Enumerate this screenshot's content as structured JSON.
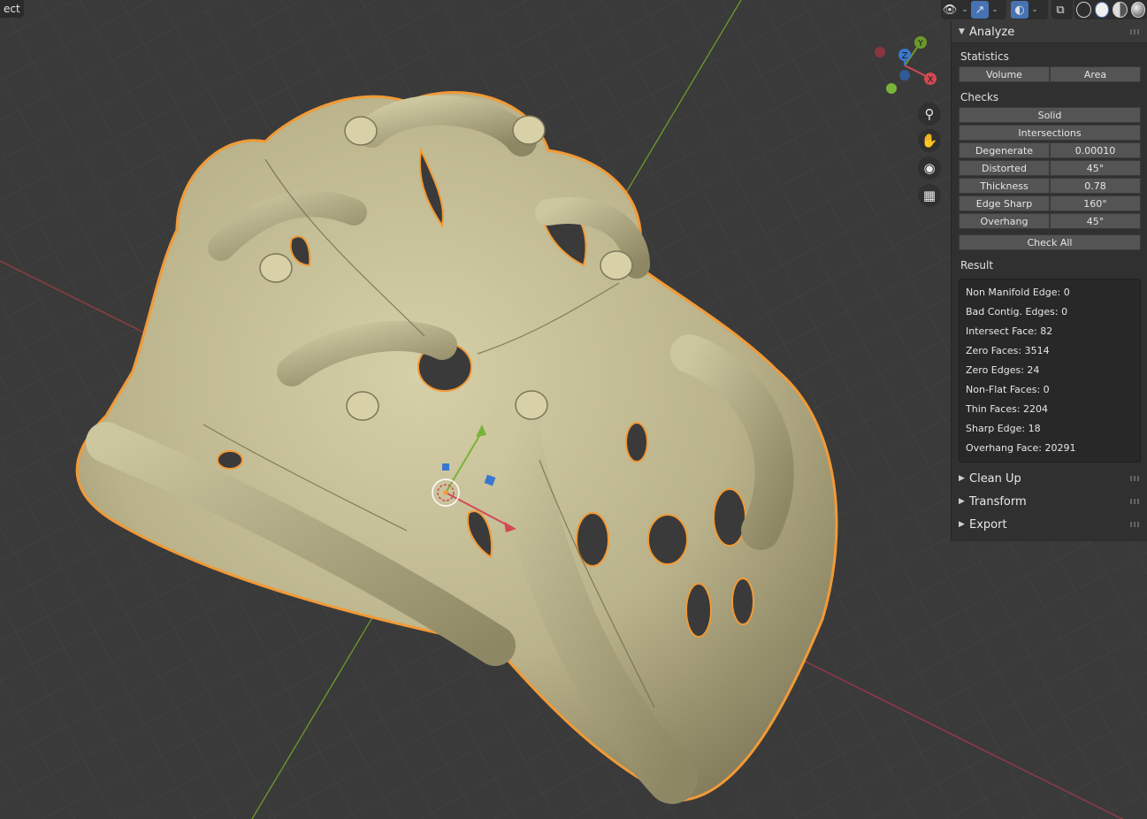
{
  "mode_label": "ect",
  "panel": {
    "title": "Analyze",
    "statistics_label": "Statistics",
    "volume_button": "Volume",
    "area_button": "Area",
    "checks_label": "Checks",
    "solid_button": "Solid",
    "intersections_button": "Intersections",
    "checks": [
      {
        "label": "Degenerate",
        "value": "0.00010"
      },
      {
        "label": "Distorted",
        "value": "45°"
      },
      {
        "label": "Thickness",
        "value": "0.78"
      },
      {
        "label": "Edge Sharp",
        "value": "160°"
      },
      {
        "label": "Overhang",
        "value": "45°"
      }
    ],
    "check_all_button": "Check All",
    "result_label": "Result",
    "results": [
      "Non Manifold Edge: 0",
      "Bad Contig. Edges: 0",
      "Intersect Face: 82",
      "Zero Faces: 3514",
      "Zero Edges: 24",
      "Non-Flat Faces: 0",
      "Thin Faces: 2204",
      "Sharp Edge: 18",
      "Overhang Face: 20291"
    ],
    "collapsed_sections": [
      "Clean Up",
      "Transform",
      "Export"
    ]
  },
  "gizmo": {
    "x_label": "X",
    "y_label": "Y",
    "z_label": "Z"
  },
  "colors": {
    "background": "#3a3a3a",
    "grid": "#444444",
    "x_axis": "#9a3b45",
    "y_axis": "#6c9a2a",
    "outline": "#f29a36",
    "mesh": "#c9c39a",
    "accent": "#4772b3"
  }
}
